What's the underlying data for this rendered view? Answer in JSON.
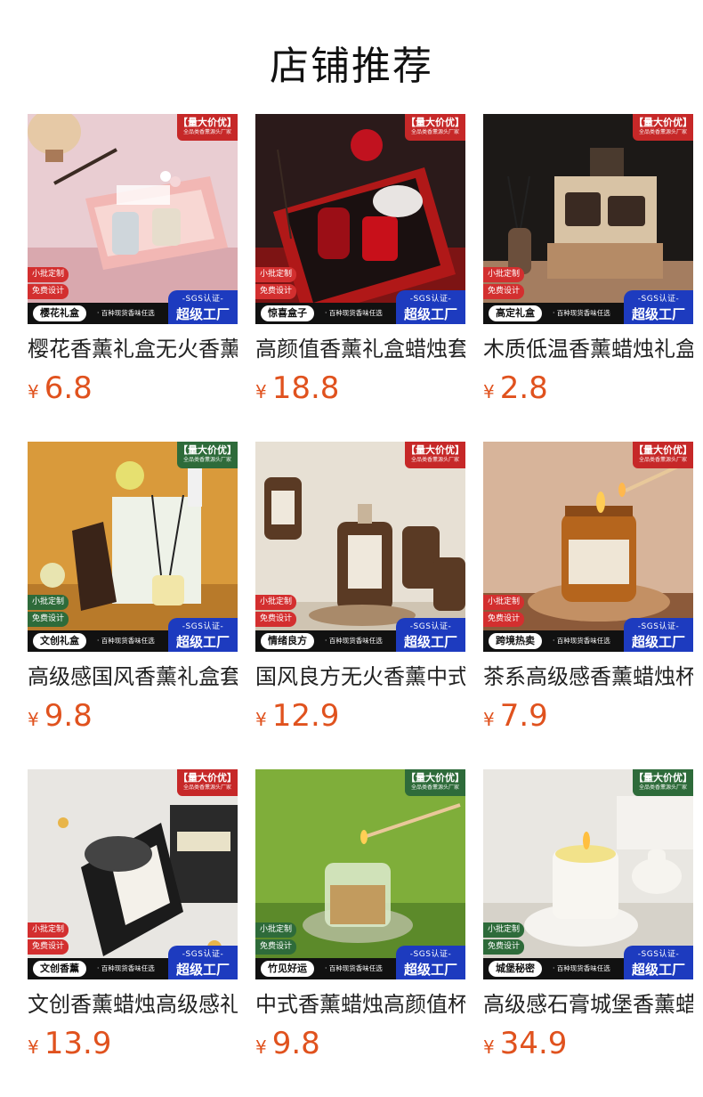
{
  "page_title": "店铺推荐",
  "common": {
    "top_tag_line1": "【量大价优】",
    "top_tag_line2": "全品类香薰源头厂家",
    "badge_custom": "小批定制",
    "badge_design": "免费设计",
    "bar_subtitle": "· 百种现货香味任选",
    "factory_line1": "-SGS认证-",
    "factory_line2": "超级工厂",
    "currency": "¥"
  },
  "products": [
    {
      "name": "樱花香薰礼盒无火香薰",
      "price": "6.8",
      "pill": "樱花礼盒",
      "image_icon": "pink-gift-box-image",
      "tag_color": "#c62828"
    },
    {
      "name": "高颜值香薰礼盒蜡烛套装",
      "price": "18.8",
      "pill": "惊喜盒子",
      "image_icon": "red-gift-box-image",
      "tag_color": "#c62828"
    },
    {
      "name": "木质低温香薰蜡烛礼盒",
      "price": "2.8",
      "pill": "高定礼盒",
      "image_icon": "wooden-box-candle-image",
      "tag_color": "#c62828"
    },
    {
      "name": "高级感国风香薰礼盒套装",
      "price": "9.8",
      "pill": "文创礼盒",
      "image_icon": "chinese-style-box-image",
      "tag_color": "#2e6b3a"
    },
    {
      "name": "国风良方无火香薰中式",
      "price": "12.9",
      "pill": "情绪良方",
      "image_icon": "brown-bottles-image",
      "tag_color": "#c62828"
    },
    {
      "name": "茶系高级感香薰蜡烛杯",
      "price": "7.9",
      "pill": "跨境热卖",
      "image_icon": "amber-candle-image",
      "tag_color": "#c62828"
    },
    {
      "name": "文创香薰蜡烛高级感礼物",
      "price": "13.9",
      "pill": "文创香薰",
      "image_icon": "black-tin-candle-image",
      "tag_color": "#c62828"
    },
    {
      "name": "中式香薰蜡烛高颜值杯",
      "price": "9.8",
      "pill": "竹见好运",
      "image_icon": "green-glass-candle-image",
      "tag_color": "#2e6b3a"
    },
    {
      "name": "高级感石膏城堡香薰蜡烛",
      "price": "34.9",
      "pill": "城堡秘密",
      "image_icon": "white-castle-candle-image",
      "tag_color": "#2e6b3a"
    }
  ]
}
